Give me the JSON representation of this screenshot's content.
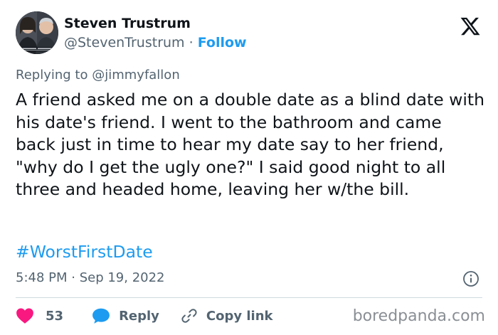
{
  "author": {
    "name": "Steven Trustrum",
    "handle": "@StevenTrustrum",
    "separator": "·",
    "follow_label": "Follow",
    "avatar_icon": "profile-photo"
  },
  "platform_icon": "x-logo-icon",
  "reply_context": {
    "prefix": "Replying to",
    "mention": "@jimmyfallon"
  },
  "tweet": {
    "text": "A friend asked me on a double date as a blind date with his date's friend. I went to the bathroom and came back just in time to hear my date say to her friend, \"why do I get the ugly one?\" I said good night to all three and headed home, leaving her w/the bill.",
    "hashtag": "#WorstFirstDate",
    "timestamp": "5:48 PM · Sep 19, 2022"
  },
  "actions": {
    "like_count": "53",
    "reply_label": "Reply",
    "copy_link_label": "Copy link"
  },
  "watermark": "boredpanda.com",
  "colors": {
    "link": "#1d9bf0",
    "like": "#f91880",
    "text": "#0f1419",
    "secondary": "#536471"
  }
}
